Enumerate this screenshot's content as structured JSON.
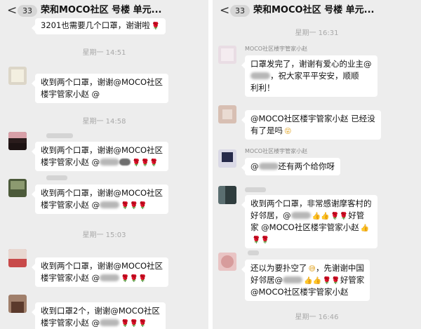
{
  "header": {
    "back": "<",
    "unread": "33",
    "title": "荣和MOCO社区 号楼 单元..."
  },
  "left": {
    "top_snippet": "3201也需要几个口罩，谢谢啦",
    "times": [
      "星期一 14:51",
      "星期一 14:58",
      "星期一 15:03"
    ],
    "messages": [
      {
        "l1": "收到两个口罩，谢谢@MOCO社区",
        "l2": "楼宇管家小赵 @"
      },
      {
        "l1": "收到两个口罩，谢谢@MOCO社区",
        "l2": "楼宇管家小赵 @"
      },
      {
        "l1": "收到两个口罩，谢谢@MOCO社区",
        "l2": "楼宇管家小赵 @"
      },
      {
        "l1": "收到两个口罩，谢谢@MOCO社区",
        "l2": "楼宇管家小赵 @"
      },
      {
        "l1": "收到口罩2个，谢谢@MOCO社区",
        "l2": "楼宇管家小赵 @"
      }
    ]
  },
  "right": {
    "times": [
      "星期一 16:31",
      "星期一 16:46"
    ],
    "sender_name": "MOCO社区楼宇管家小赵",
    "messages": [
      {
        "l1": "口罩发完了，谢谢有爱心的业主@",
        "l2": "，祝大家平平安安，顺顺",
        "l3": "利利！"
      },
      {
        "l1": "@MOCO社区楼宇管家小赵 已经没",
        "l2": "有了是吗"
      },
      {
        "l1": "@",
        "l1b": "还有两个给你呀"
      },
      {
        "l1": "收到两个口罩，非常感谢摩客村的",
        "l2": "好邻居，@",
        "l2b": "好管",
        "l3": "家 @MOCO社区楼宇管家小赵"
      },
      {
        "l1": "还以为要扑空了",
        "l1b": "，先谢谢中国",
        "l2": "好邻居@",
        "l2b": "好管家",
        "l3": "@MOCO社区楼宇管家小赵"
      }
    ]
  },
  "icons": {
    "rose": "🌹",
    "thumb": "👍",
    "grin": "😝",
    "sweat": "😅"
  },
  "colors": {
    "bg": "#ededed",
    "bubble": "#ffffff",
    "time": "#a9a9a9"
  }
}
